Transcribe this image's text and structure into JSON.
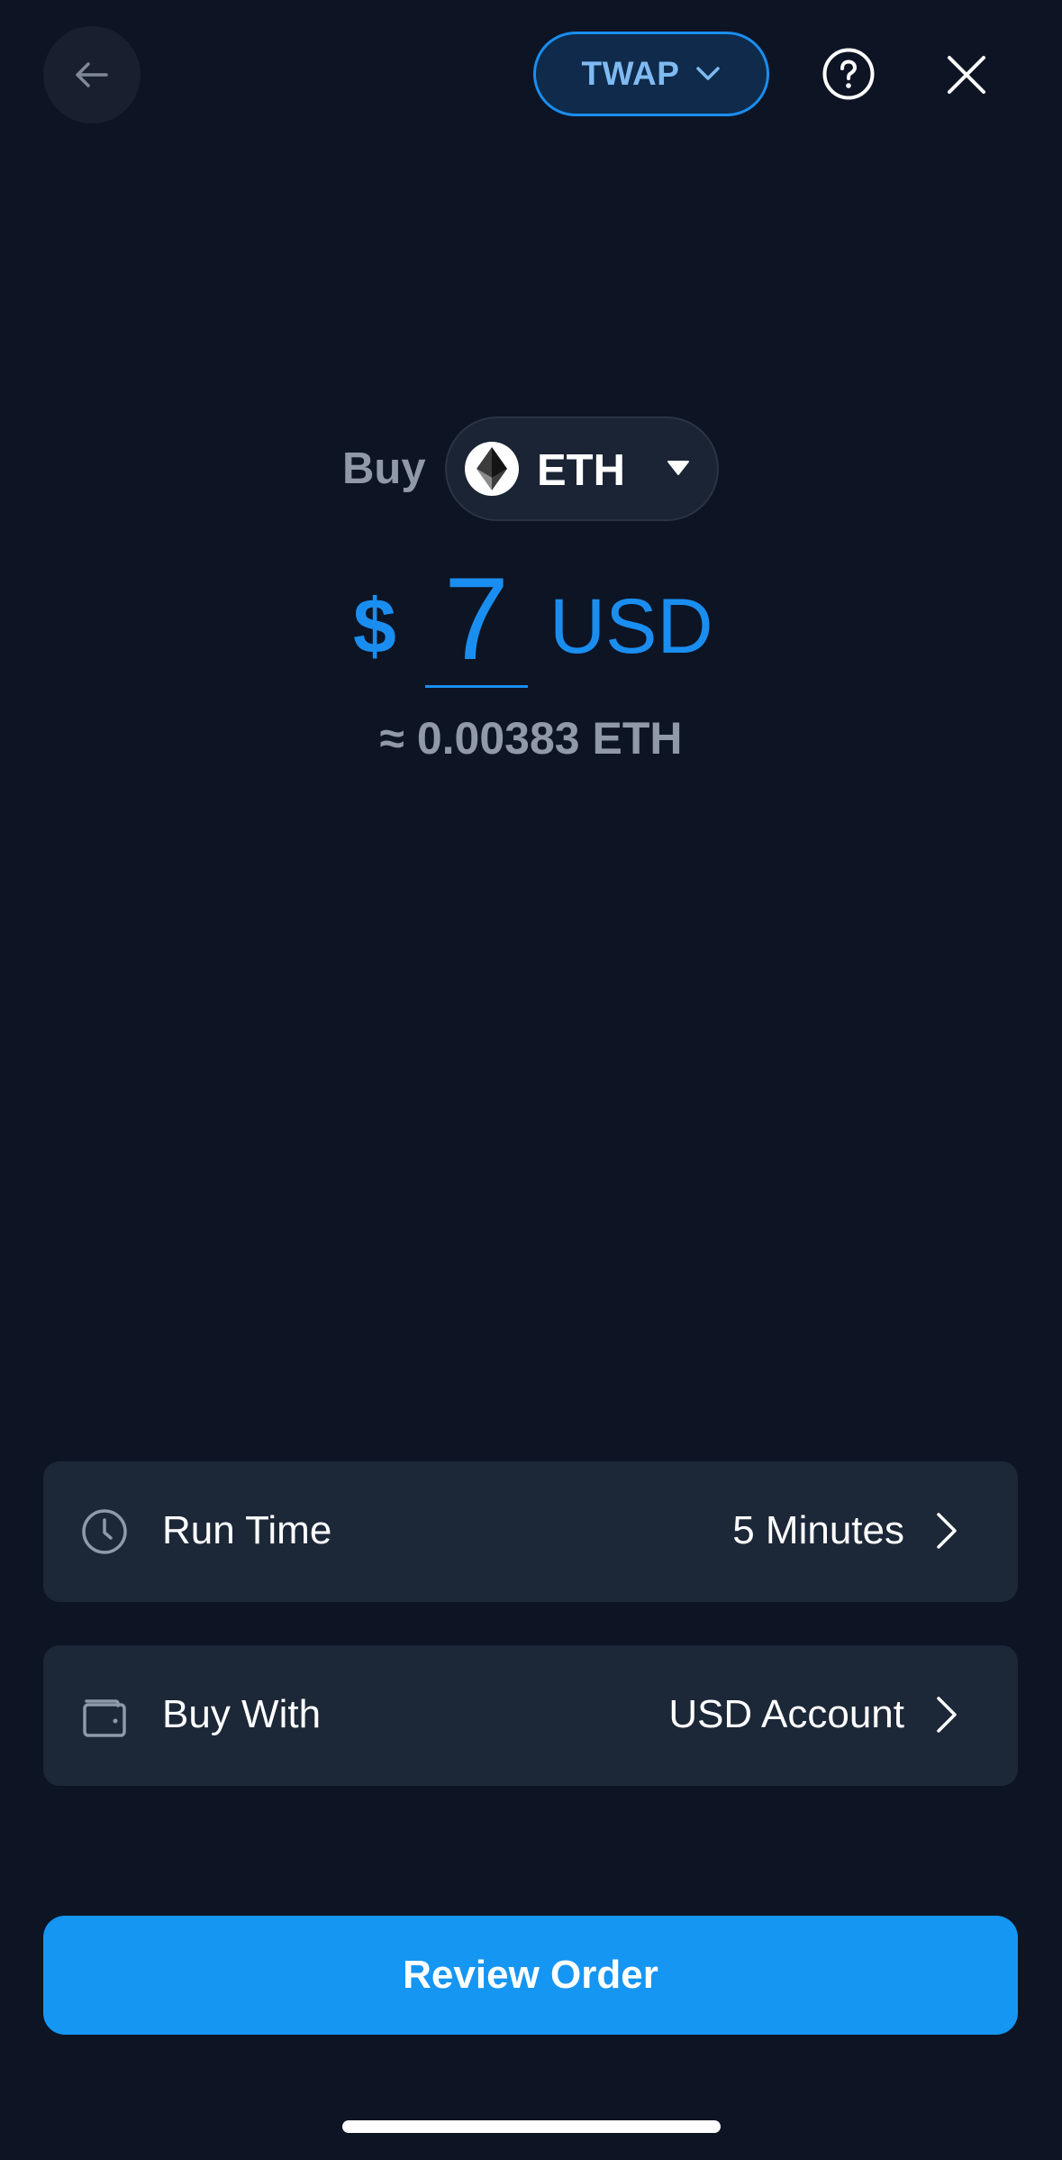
{
  "header": {
    "back_icon": "arrow-left-icon",
    "order_type_label": "TWAP",
    "order_type_icon": "chevron-down-icon",
    "help_icon": "question-circle-icon",
    "close_icon": "close-icon"
  },
  "buy": {
    "label": "Buy",
    "asset": "ETH",
    "asset_icon": "ethereum-logo-icon",
    "caret_icon": "caret-down-icon"
  },
  "amount": {
    "currency_symbol": "$",
    "value": "7",
    "currency_code": "USD",
    "conversion": "≈ 0.00383 ETH"
  },
  "settings": [
    {
      "icon": "clock-icon",
      "label": "Run Time",
      "value": "5 Minutes",
      "chevron_icon": "chevron-right-icon"
    },
    {
      "icon": "wallet-icon",
      "label": "Buy With",
      "value": "USD Account",
      "chevron_icon": "chevron-right-icon"
    }
  ],
  "actions": {
    "review_label": "Review Order"
  },
  "colors": {
    "background": "#0d1424",
    "accent": "#1a8ef0",
    "primary_button": "#1596f3",
    "row_background": "#1c2738",
    "muted_text": "#8f99a8"
  }
}
